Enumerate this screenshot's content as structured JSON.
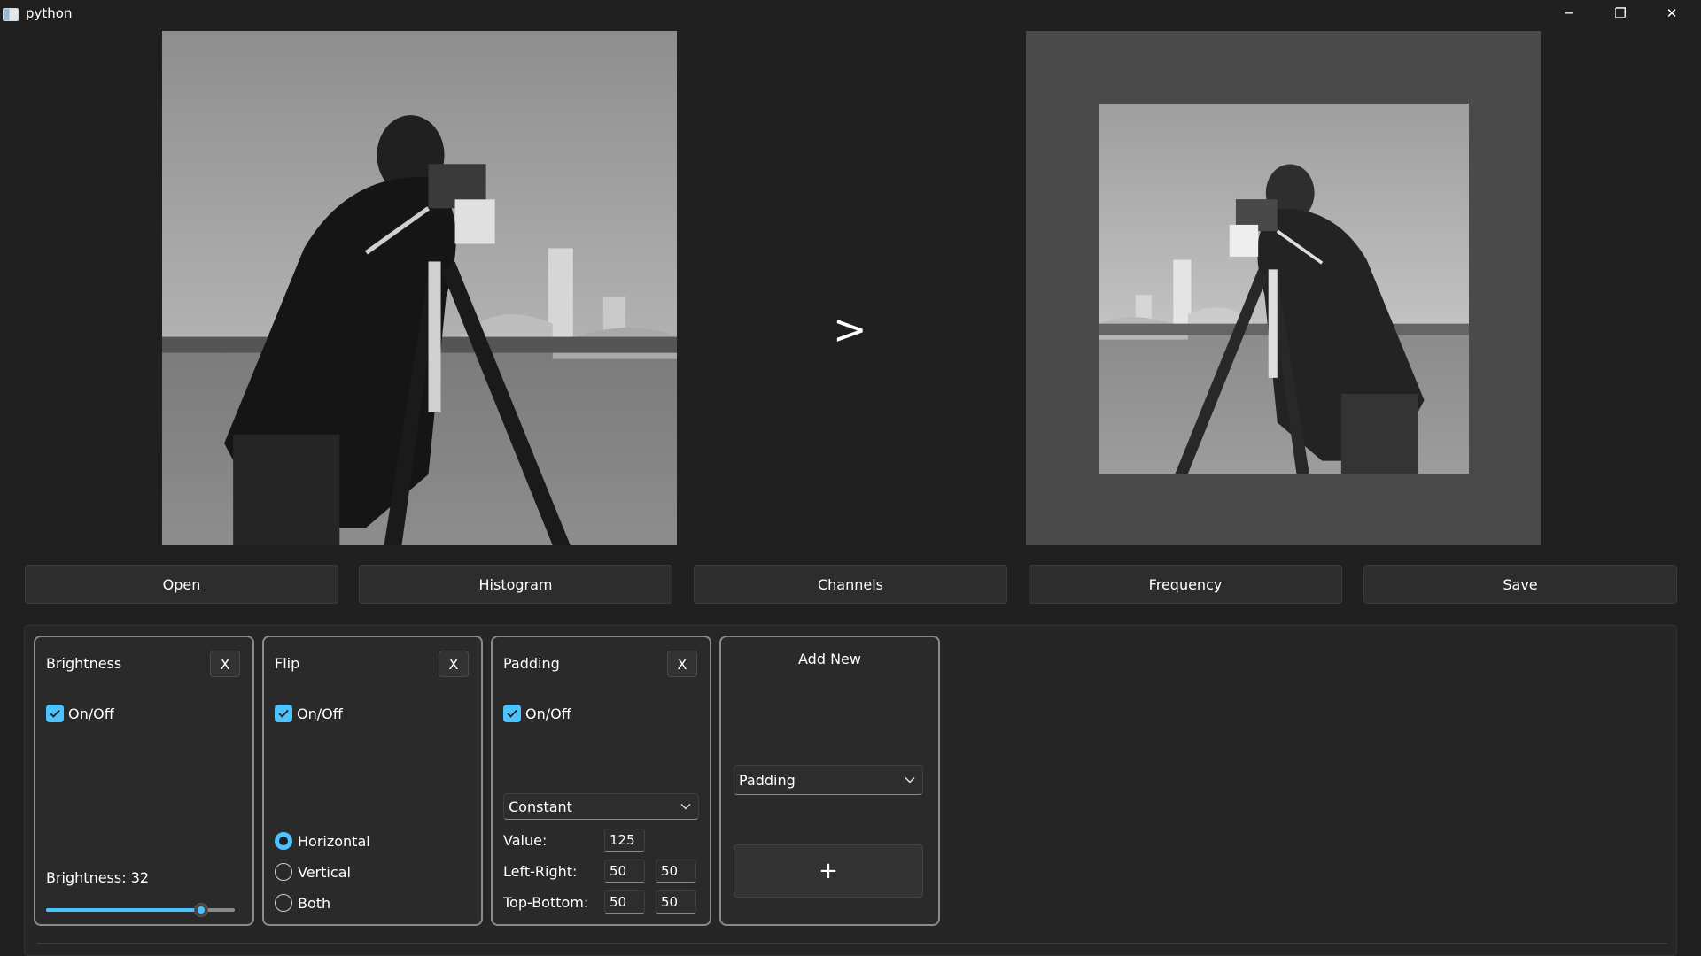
{
  "window": {
    "title": "python",
    "minimize_glyph": "─",
    "restore_glyph": "❐",
    "close_glyph": "✕"
  },
  "preview": {
    "arrow": ">"
  },
  "toolbar": {
    "buttons": [
      "Open",
      "Histogram",
      "Channels",
      "Frequency",
      "Save"
    ]
  },
  "filters": {
    "brightness": {
      "title": "Brightness",
      "close": "X",
      "enabled_label": "On/Off",
      "enabled": true,
      "value_label": "Brightness: 32",
      "slider_fraction": 0.82
    },
    "flip": {
      "title": "Flip",
      "close": "X",
      "enabled_label": "On/Off",
      "enabled": true,
      "options": [
        "Horizontal",
        "Vertical",
        "Both"
      ],
      "selected": "Horizontal"
    },
    "padding": {
      "title": "Padding",
      "close": "X",
      "enabled_label": "On/Off",
      "enabled": true,
      "mode": "Constant",
      "value_label": "Value:",
      "value": "125",
      "left_right_label": "Left-Right:",
      "left": "50",
      "right": "50",
      "top_bottom_label": "Top-Bottom:",
      "top": "50",
      "bottom": "50"
    },
    "add_new": {
      "title": "Add New",
      "selected_filter": "Padding",
      "add_glyph": "+"
    }
  },
  "icons": {
    "checkbox": "checkmark-icon",
    "dropdown": "chevron-down-icon",
    "app": "python-app-icon"
  },
  "colors": {
    "accent": "#4cc2ff",
    "background": "#202020",
    "card_border": "#8a8a8a"
  }
}
